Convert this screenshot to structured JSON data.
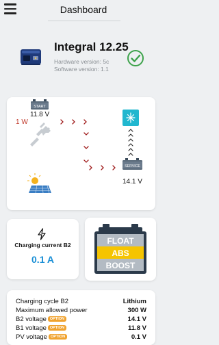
{
  "header": {
    "title": "Dashboard"
  },
  "device": {
    "name": "Integral 12.25",
    "hardware_version": "Hardware version: 5c",
    "software_version": "Software version: 1.1",
    "status_color": "#3ca24a"
  },
  "flow": {
    "input_power": "1 W",
    "start_label": "START",
    "start_voltage": "11.8 V",
    "service_label": "SERVICE",
    "service_voltage": "14.1 V",
    "input_color": "#c0392b",
    "arrow_color": "#a01c1c"
  },
  "charging": {
    "label": "Charging current B2",
    "value": "0.1 A",
    "value_color": "#1a8fd6"
  },
  "stages": {
    "float_label": "FLOAT",
    "abs_label": "ABS",
    "boost_label": "BOOST",
    "active_stage": "ABS",
    "active_color": "#f5c400"
  },
  "stats": {
    "rows": [
      {
        "label": "Charging cycle B2",
        "value": "Lithium",
        "badge": ""
      },
      {
        "label": "Maximum allowed power",
        "value": "300 W",
        "badge": ""
      },
      {
        "label": "B2 voltage",
        "value": "14.1 V",
        "badge": "OPTION"
      },
      {
        "label": "B1 voltage",
        "value": "11.8 V",
        "badge": "OPTION"
      },
      {
        "label": "PV voltage",
        "value": "0.1 V",
        "badge": "OPTION"
      }
    ]
  }
}
